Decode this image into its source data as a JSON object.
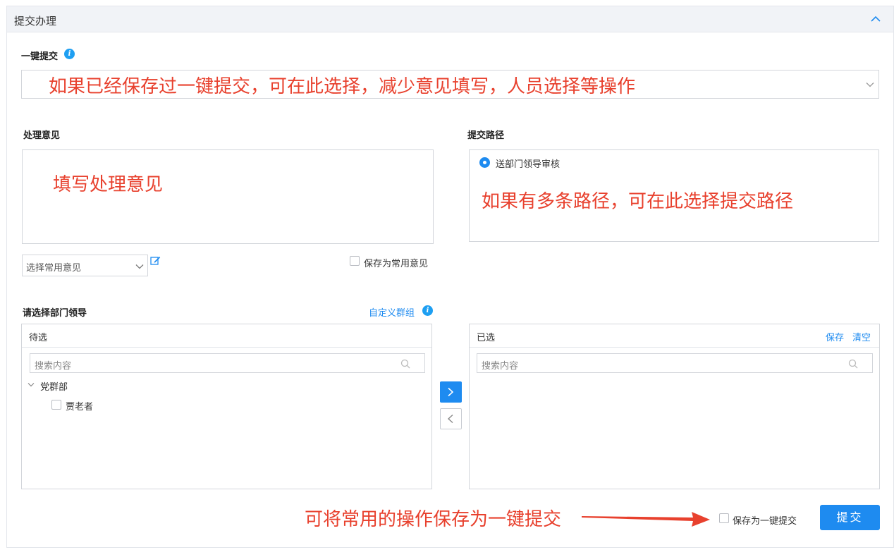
{
  "panel": {
    "title": "提交办理"
  },
  "one_click": {
    "label": "一键提交",
    "info_icon": "info-icon",
    "annotation": "如果已经保存过一键提交，可在此选择，减少意见填写，人员选择等操作"
  },
  "opinion": {
    "label": "处理意见",
    "annotation": "填写处理意见",
    "common_select_value": "选择常用意见",
    "edit_icon": "edit-icon",
    "save_common_label": "保存为常用意见"
  },
  "path": {
    "label": "提交路径",
    "option": "送部门领导审核",
    "annotation": "如果有多条路径，可在此选择提交路径"
  },
  "leader": {
    "label": "请选择部门领导",
    "custom_group_link": "自定义群组",
    "pending": {
      "title": "待选",
      "search_placeholder": "搜索内容",
      "tree": {
        "group": "党群部",
        "members": [
          "贾老者"
        ]
      }
    },
    "selected": {
      "title": "已选",
      "save_link": "保存",
      "clear_link": "清空",
      "search_placeholder": "搜索内容"
    }
  },
  "footer": {
    "annotation": "可将常用的操作保存为一键提交",
    "save_one_click_label": "保存为一键提交",
    "submit_label": "提交"
  },
  "colors": {
    "accent": "#1e8bf0",
    "annotation": "#e8412e",
    "header_bg": "#f1f3f7"
  }
}
